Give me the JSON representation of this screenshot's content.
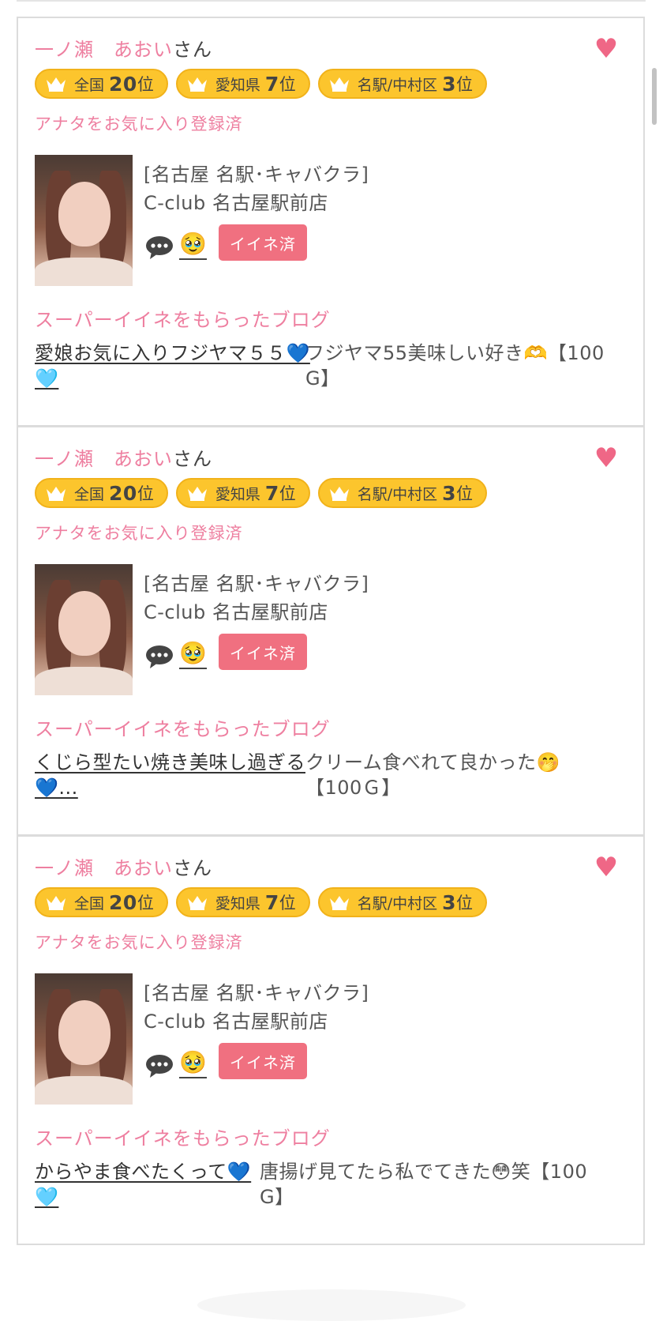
{
  "cards": [
    {
      "name": "一ノ瀬　あおい",
      "honorific": "さん",
      "heart_icon": "heart-icon",
      "badges": [
        {
          "area": "全国",
          "num": "20",
          "suffix": "位"
        },
        {
          "area": "愛知県",
          "num": "7",
          "suffix": "位"
        },
        {
          "area": "名駅/中村区",
          "num": "3",
          "suffix": "位"
        }
      ],
      "favorite_status": "アナタをお気に入り登録済",
      "shop_category": "[名古屋 名駅･キャバクラ]",
      "shop_name": "C-club 名古屋駅前店",
      "reaction_emoji": "🥹",
      "like_label": "イイネ済",
      "section_title": "スーパーイイネをもらったブログ",
      "blog_title_line1": "愛娘お気に入りフジヤマ５５💙",
      "blog_title_line2": "🩵",
      "blog_extra_line1": "フジヤマ55美味しい好き🫶【100",
      "blog_extra_line2": "G】"
    },
    {
      "name": "一ノ瀬　あおい",
      "honorific": "さん",
      "heart_icon": "heart-icon",
      "badges": [
        {
          "area": "全国",
          "num": "20",
          "suffix": "位"
        },
        {
          "area": "愛知県",
          "num": "7",
          "suffix": "位"
        },
        {
          "area": "名駅/中村区",
          "num": "3",
          "suffix": "位"
        }
      ],
      "favorite_status": "アナタをお気に入り登録済",
      "shop_category": "[名古屋 名駅･キャバクラ]",
      "shop_name": "C-club 名古屋駅前店",
      "reaction_emoji": "🥹",
      "like_label": "イイネ済",
      "section_title": "スーパーイイネをもらったブログ",
      "blog_title_line1": "くじら型たい焼き美味し過ぎる",
      "blog_title_line2": "💙...",
      "blog_extra_line1": "クリーム食べれて良かった🤭",
      "blog_extra_line2": "【100Ｇ】"
    },
    {
      "name": "一ノ瀬　あおい",
      "honorific": "さん",
      "heart_icon": "heart-icon",
      "badges": [
        {
          "area": "全国",
          "num": "20",
          "suffix": "位"
        },
        {
          "area": "愛知県",
          "num": "7",
          "suffix": "位"
        },
        {
          "area": "名駅/中村区",
          "num": "3",
          "suffix": "位"
        }
      ],
      "favorite_status": "アナタをお気に入り登録済",
      "shop_category": "[名古屋 名駅･キャバクラ]",
      "shop_name": "C-club 名古屋駅前店",
      "reaction_emoji": "🥹",
      "like_label": "イイネ済",
      "section_title": "スーパーイイネをもらったブログ",
      "blog_title_line1": "からやま食べたくって💙",
      "blog_title_line2": "🩵",
      "blog_extra_line1": "唐揚げ見てたら私でてきた😳笑【100",
      "blog_extra_line2": "G】"
    }
  ],
  "colors": {
    "accent_pink": "#ee7fa0",
    "badge_yellow": "#fcc52d",
    "like_button": "#f07080",
    "heart": "#ef6786"
  }
}
